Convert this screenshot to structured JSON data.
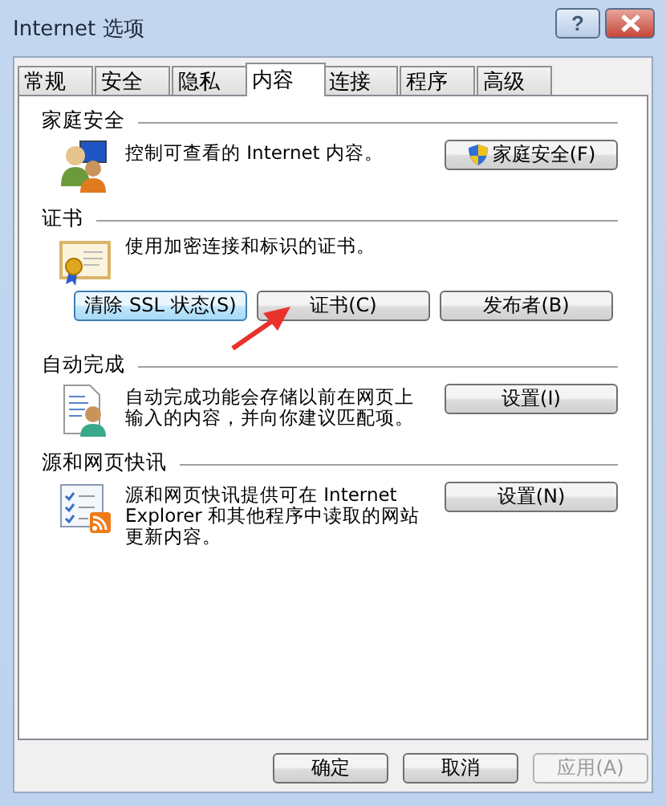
{
  "window": {
    "title": "Internet 选项",
    "help_button": "?"
  },
  "tabs": [
    {
      "label": "常规",
      "selected": false
    },
    {
      "label": "安全",
      "selected": false
    },
    {
      "label": "隐私",
      "selected": false
    },
    {
      "label": "内容",
      "selected": true
    },
    {
      "label": "连接",
      "selected": false
    },
    {
      "label": "程序",
      "selected": false
    },
    {
      "label": "高级",
      "selected": false
    }
  ],
  "sections": [
    {
      "title": "家庭安全",
      "kind": "family",
      "description": "控制可查看的 Internet 内容。",
      "buttons": [
        {
          "label": "家庭安全(F)",
          "shield": true,
          "highlighted": false
        }
      ]
    },
    {
      "title": "证书",
      "kind": "certificate",
      "description": "使用加密连接和标识的证书。",
      "buttons": [
        {
          "label": "清除 SSL 状态(S)",
          "shield": false,
          "highlighted": true
        },
        {
          "label": "证书(C)",
          "shield": false,
          "highlighted": false
        },
        {
          "label": "发布者(B)",
          "shield": false,
          "highlighted": false
        }
      ]
    },
    {
      "title": "自动完成",
      "kind": "autocomplete",
      "description": "自动完成功能会存储以前在网页上输入的内容，并向你建议匹配项。",
      "buttons": [
        {
          "label": "设置(I)",
          "shield": false,
          "highlighted": false
        }
      ]
    },
    {
      "title": "源和网页快讯",
      "kind": "feeds",
      "description": "源和网页快讯提供可在 Internet Explorer 和其他程序中读取的网站更新内容。",
      "buttons": [
        {
          "label": "设置(N)",
          "shield": false,
          "highlighted": false
        }
      ]
    }
  ],
  "footer_buttons": [
    {
      "label": "确定",
      "disabled": false
    },
    {
      "label": "取消",
      "disabled": false
    },
    {
      "label": "应用(A)",
      "disabled": true
    }
  ]
}
